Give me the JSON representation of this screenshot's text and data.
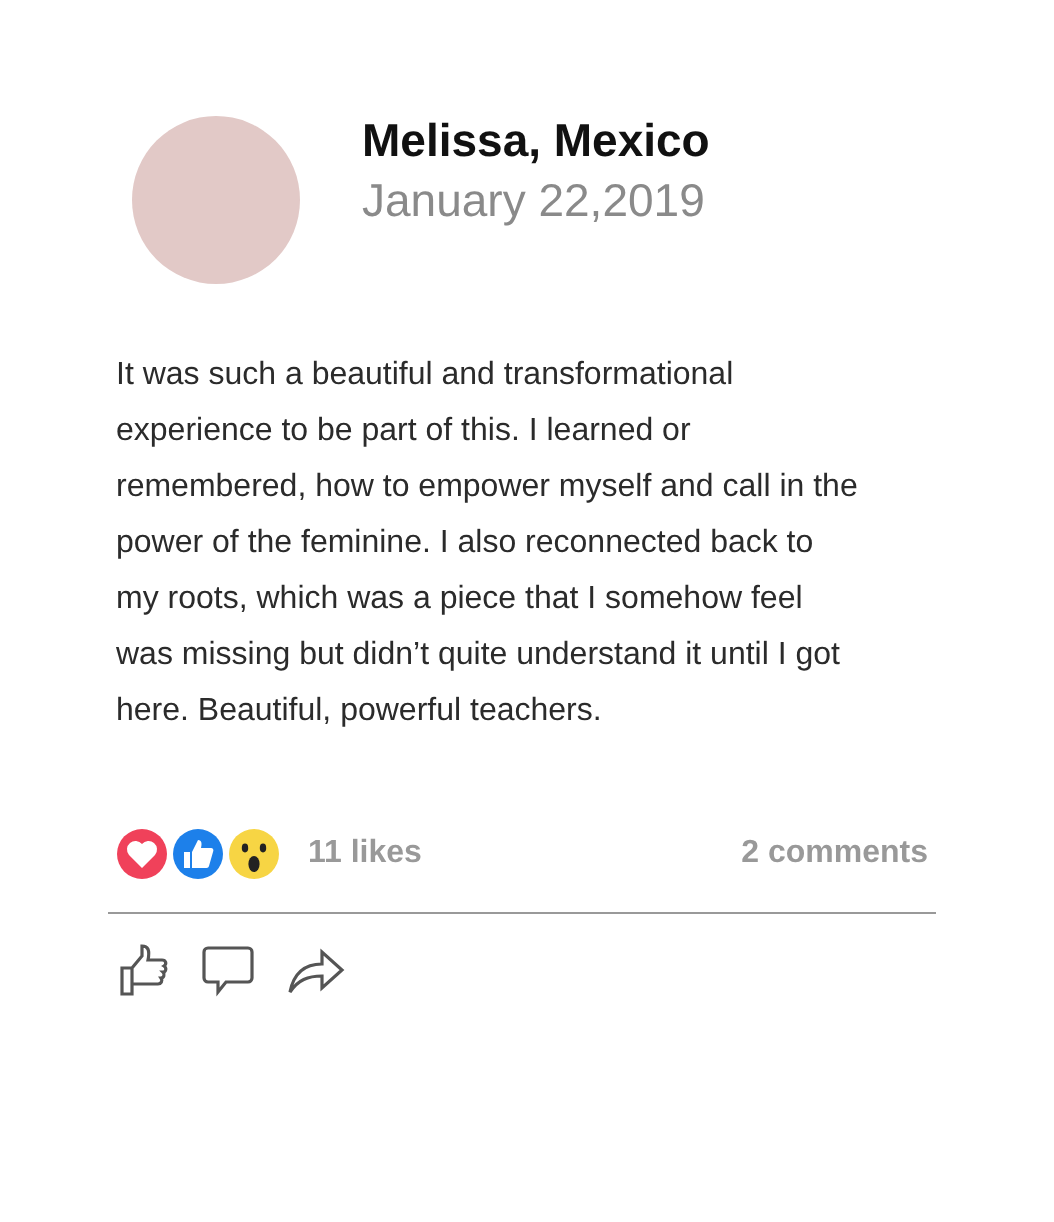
{
  "post": {
    "author": "Melissa, Mexico",
    "date": "January 22,2019",
    "text": "It was such a beautiful and transformational experience to be part of this. I learned or remembered, how to empower myself and call in the power of the feminine. I also reconnected back to my roots, which was a piece that I somehow feel was missing but didn’t quite understand it until I got here. Beautiful, powerful teachers."
  },
  "stats": {
    "likes": "11 likes",
    "comments": "2 comments"
  }
}
